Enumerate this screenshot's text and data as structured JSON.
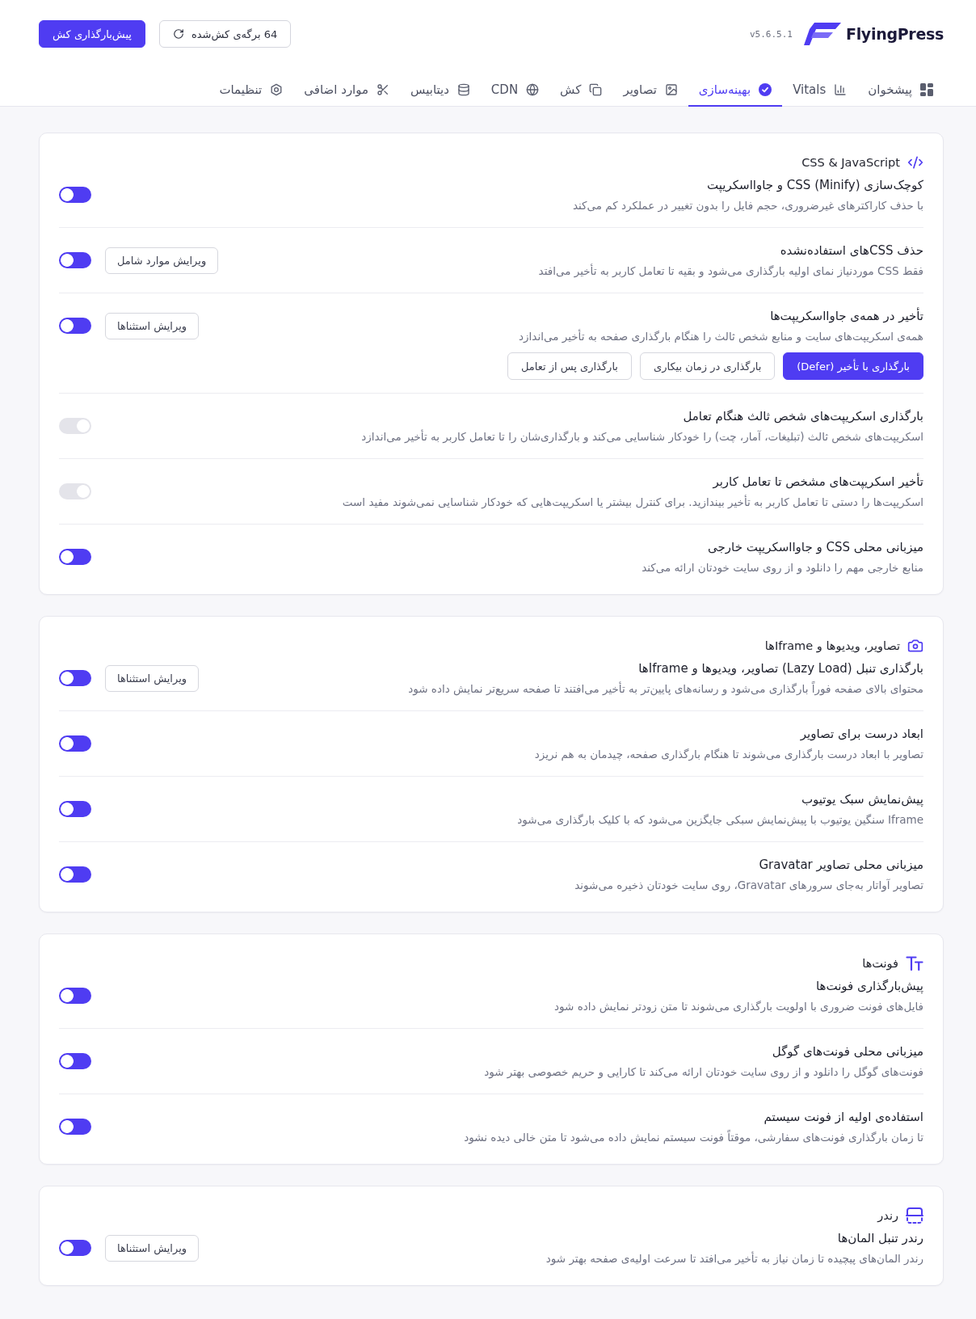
{
  "header": {
    "logo": "FlyingPress",
    "version": "v5.6.5.1",
    "buttons": [
      {
        "label": "64 برگه‌ی کش‌شده",
        "kind": "secondary"
      },
      {
        "label": "پیش‌بارگذاری کش",
        "kind": "primary"
      }
    ]
  },
  "tabs": [
    {
      "label": "پیشخوان",
      "selected": false
    },
    {
      "label": "Vitals",
      "selected": false
    },
    {
      "label": "بهینه‌سازی",
      "selected": true
    },
    {
      "label": "تصاویر",
      "selected": false
    },
    {
      "label": "کش",
      "selected": false
    },
    {
      "label": "CDN",
      "selected": false
    },
    {
      "label": "دیتابیس",
      "selected": false
    },
    {
      "label": "موارد اضافی",
      "selected": false
    },
    {
      "label": "تنظیمات",
      "selected": false
    }
  ],
  "sections": [
    {
      "title": "CSS & JavaScript",
      "settings": [
        {
          "title": "کوچک‌سازی CSS (Minify) و جاوااسکریپت",
          "description": "با حذف کاراکترهای غیرضروری، حجم فایل را بدون تغییر در عملکرد کم می‌کند",
          "on": true
        },
        {
          "title": "حذف CSSهای استفاده‌نشده",
          "description": "فقط CSS موردنیاز نمای اولیه بارگذاری می‌شود و بقیه تا تعامل کاربر به تأخیر می‌افتد",
          "on": true,
          "button": "ویرایش موارد شامل"
        },
        {
          "title": "تأخیر در همه‌ی جاوااسکریپت‌ها",
          "description": "همه‌ی اسکریپت‌های سایت و منابع شخص ثالث را هنگام بارگذاری صفحه به تأخیر می‌اندازد",
          "on": true,
          "button": "ویرایش استثناها",
          "options": [
            {
              "label": "بارگذاری با تأخیر (Defer)",
              "selected": true
            },
            {
              "label": "بارگذاری در زمان بیکاری",
              "selected": false
            },
            {
              "label": "بارگذاری پس از تعامل",
              "selected": false
            }
          ]
        },
        {
          "title": "بارگذاری اسکریپت‌های شخص ثالث هنگام تعامل",
          "description": "اسکریپت‌های شخص ثالث (تبلیغات، آمار، چت) را خودکار شناسایی می‌کند و بارگذاری‌شان را تا تعامل کاربر به تأخیر می‌اندازد",
          "on": false
        },
        {
          "title": "تأخیر اسکریپت‌های مشخص تا تعامل کاربر",
          "description": "اسکریپت‌ها را دستی تا تعامل کاربر به تأخیر بیندازید. برای کنترل بیشتر یا اسکریپت‌هایی که خودکار شناسایی نمی‌شوند مفید است",
          "on": false
        },
        {
          "title": "میزبانی محلی CSS و جاوااسکریپت خارجی",
          "description": "منابع خارجی مهم را دانلود و از روی سایت خودتان ارائه می‌کند",
          "on": true
        }
      ]
    },
    {
      "title": "تصاویر، ویدیوها و Iframeها",
      "settings": [
        {
          "title": "بارگذاری تنبل (Lazy Load) تصاویر، ویدیوها و Iframeها",
          "description": "محتوای بالای صفحه فوراً بارگذاری می‌شود و رسانه‌های پایین‌تر به تأخیر می‌افتند تا صفحه سریع‌تر نمایش داده شود",
          "on": true,
          "button": "ویرایش استثناها"
        },
        {
          "title": "ابعاد درست برای تصاویر",
          "description": "تصاویر با ابعاد درست بارگذاری می‌شوند تا هنگام بارگذاری صفحه، چیدمان به هم نریزد",
          "on": true
        },
        {
          "title": "پیش‌نمایش سبک یوتیوب",
          "description": "Iframe سنگین یوتیوب با پیش‌نمایش سبکی جایگزین می‌شود که با کلیک بارگذاری می‌شود",
          "on": true
        },
        {
          "title": "میزبانی محلی تصاویر Gravatar",
          "description": "تصاویر آواتار به‌جای سرورهای Gravatar، روی سایت خودتان ذخیره می‌شوند",
          "on": true
        }
      ]
    },
    {
      "title": "فونت‌ها",
      "settings": [
        {
          "title": "پیش‌بارگذاری فونت‌ها",
          "description": "فایل‌های فونت ضروری با اولویت بارگذاری می‌شوند تا متن زودتر نمایش داده شود",
          "on": true
        },
        {
          "title": "میزبانی محلی فونت‌های گوگل",
          "description": "فونت‌های گوگل را دانلود و از روی سایت خودتان ارائه می‌کند تا کارایی و حریم خصوصی بهتر شود",
          "on": true
        },
        {
          "title": "استفاده‌ی اولیه از فونت سیستم",
          "description": "تا زمان بارگذاری فونت‌های سفارشی، موقتاً فونت سیستم نمایش داده می‌شود تا متن خالی دیده نشود",
          "on": true
        }
      ]
    },
    {
      "title": "رندر",
      "settings": [
        {
          "title": "رندر تنبل المان‌ها",
          "description": "رندر المان‌های پیچیده تا زمان نیاز به تأخیر می‌افتد تا سرعت اولیه‌ی صفحه بهتر شود",
          "on": true,
          "button": "ویرایش استثناها"
        }
      ]
    }
  ]
}
